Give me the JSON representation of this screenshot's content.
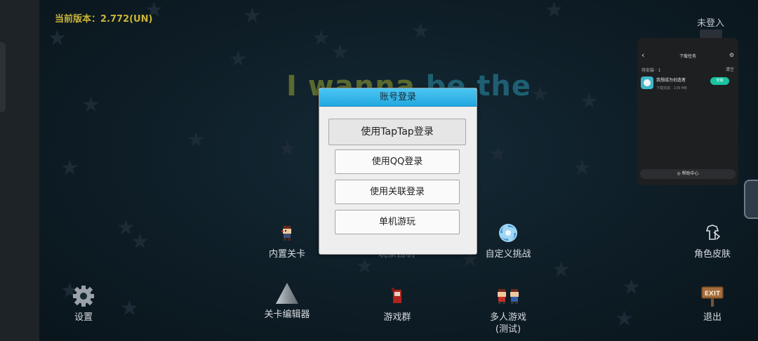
{
  "header": {
    "version": "当前版本：2.772(UN)",
    "login_status": "未登入"
  },
  "title": {
    "part1": "I  wanna ",
    "part2": "be the"
  },
  "dialog": {
    "title": "账号登录",
    "buttons": [
      "使用TapTap登录",
      "使用QQ登录",
      "使用关联登录",
      "单机游玩"
    ]
  },
  "menu": {
    "builtin_levels": "内置关卡",
    "player_made": "玩家自制",
    "custom_challenge": "自定义挑战",
    "character_skin": "角色皮肤",
    "settings": "设置",
    "level_editor": "关卡编辑器",
    "game_group": "游戏群",
    "multiplayer_line1": "多人游戏",
    "multiplayer_line2": "(测试)",
    "exit": "退出"
  },
  "download_panel": {
    "title": "下载任务",
    "section_label": "待安装 · 1",
    "clear_label": "清空",
    "app_name": "我想成为创造者",
    "app_info": "下载完成 · 239 MB",
    "install_label": "安装",
    "help_label": "帮助中心"
  },
  "icons": {
    "back": "chevron-left-icon",
    "settings": "gear-icon",
    "headset": "headset-icon"
  },
  "colors": {
    "accent": "#22a8e0",
    "version_text": "#c8b536",
    "install": "#19c4a0"
  }
}
